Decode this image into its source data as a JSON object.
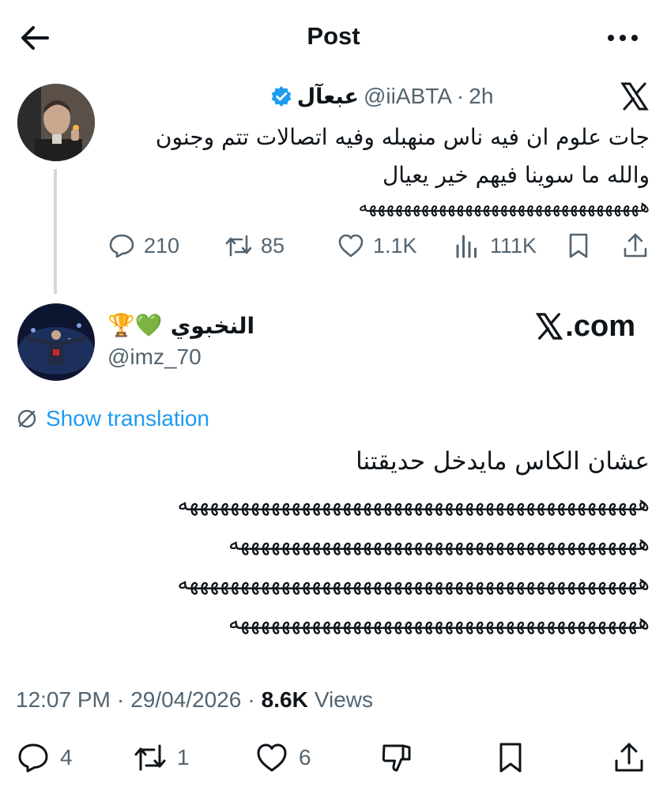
{
  "header": {
    "title": "Post",
    "back_icon": "arrow-left-icon",
    "more_icon": "more-horizontal-icon"
  },
  "parent_tweet": {
    "display_name": "عبعآل",
    "handle": "@iiABTA",
    "separator": "·",
    "time": "2h",
    "text": "جات علوم ان فيه ناس منهبله وفيه اتصالات تتم وجنون والله ما سوينا فيهم خير يعيال",
    "laugh": "ههههههههههههههههههههههههههههههههه",
    "actions": {
      "replies": "210",
      "reposts": "85",
      "likes": "1.1K",
      "views": "111K"
    }
  },
  "tweet": {
    "display_name": "النخبوي",
    "emojis": "🏆💚",
    "handle": "@imz_70",
    "watermark": ".com",
    "show_translation": "Show translation",
    "text": "عشان الكاس مايدخل حديقتنا",
    "laugh_lines": [
      "هههههههههههههههههههههههههههههههههههههههههههههه",
      "ههههههههههههههههههههههههههههههههههههههههه",
      "هههههههههههههههههههههههههههههههههههههههههههههه",
      "ههههههههههههههههههههههههههههههههههههههههه"
    ],
    "time": "12:07 PM",
    "date": "29/04/2026",
    "views_count": "8.6K",
    "views_label": "Views",
    "separator": "·",
    "actions": {
      "replies": "4",
      "reposts": "1",
      "likes": "6"
    }
  },
  "colors": {
    "accent": "#1d9bf0",
    "text": "#0f1419",
    "muted": "#536471",
    "line": "#cfd9de"
  }
}
